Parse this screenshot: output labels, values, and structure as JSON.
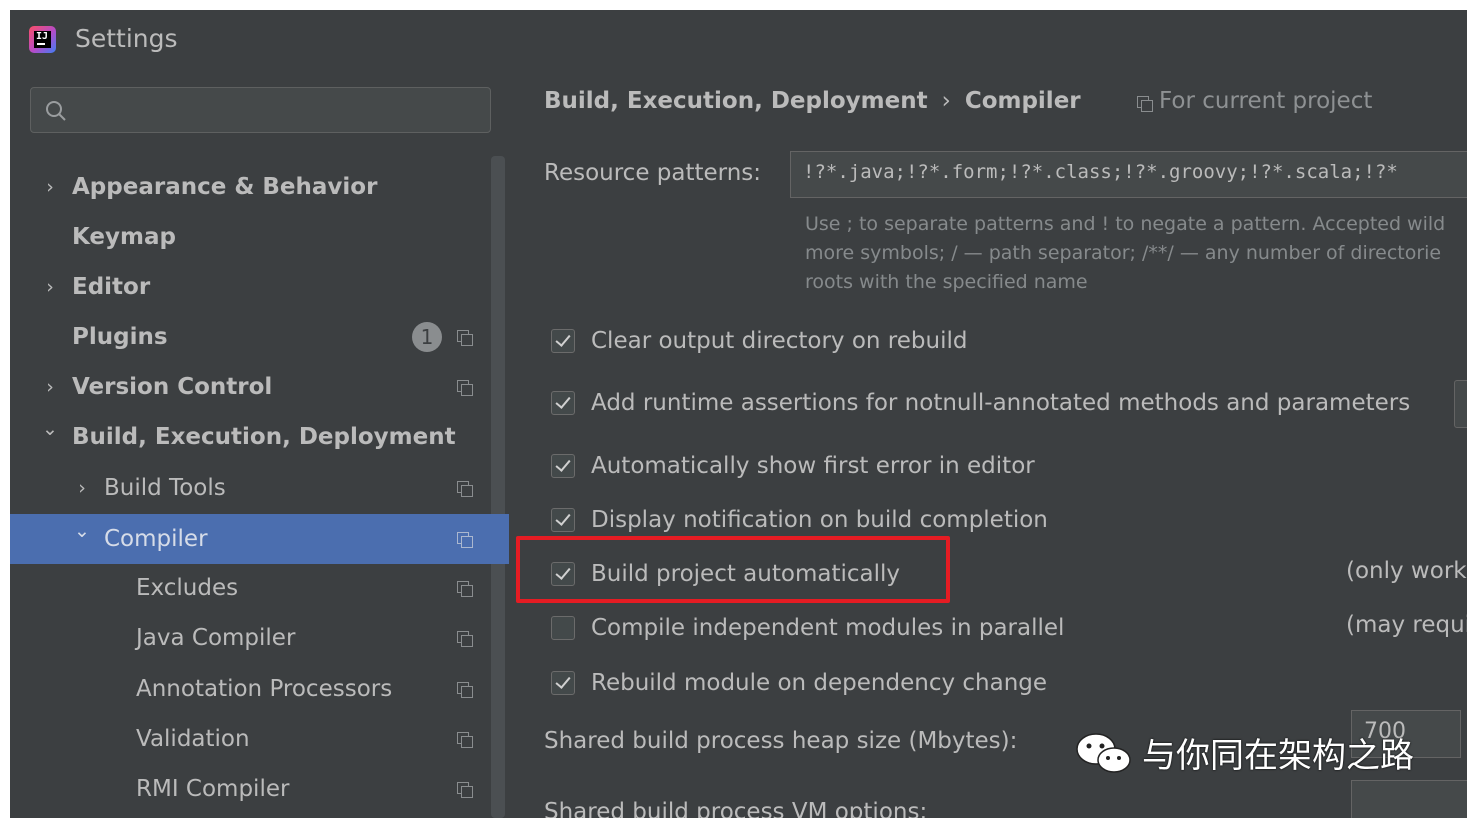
{
  "window": {
    "title": "Settings"
  },
  "search": {
    "placeholder": ""
  },
  "tree": [
    {
      "label": "Appearance & Behavior",
      "arrow": "›",
      "bold": true
    },
    {
      "label": "Keymap",
      "arrow": "",
      "bold": true
    },
    {
      "label": "Editor",
      "arrow": "›",
      "bold": true
    },
    {
      "label": "Plugins",
      "arrow": "",
      "bold": true,
      "badge": "1"
    },
    {
      "label": "Version Control",
      "arrow": "›",
      "bold": true
    },
    {
      "label": "Build, Execution, Deployment",
      "arrow": "⌄",
      "bold": true
    },
    {
      "label": "Build Tools",
      "arrow": "›",
      "bold": false
    },
    {
      "label": "Compiler",
      "arrow": "⌄",
      "bold": false,
      "selected": true
    },
    {
      "label": "Excludes",
      "arrow": "",
      "bold": false
    },
    {
      "label": "Java Compiler",
      "arrow": "",
      "bold": false
    },
    {
      "label": "Annotation Processors",
      "arrow": "",
      "bold": false
    },
    {
      "label": "Validation",
      "arrow": "",
      "bold": false
    },
    {
      "label": "RMI Compiler",
      "arrow": "",
      "bold": false
    }
  ],
  "breadcrumb": {
    "parent": "Build, Execution, Deployment",
    "separator": "›",
    "current": "Compiler",
    "scope": "For current project"
  },
  "resource": {
    "label": "Resource patterns:",
    "value": "!?*.java;!?*.form;!?*.class;!?*.groovy;!?*.scala;!?*",
    "hint_1": "Use ; to separate patterns and ! to negate a pattern. Accepted wild",
    "hint_2": "more symbols; / — path separator; /**/ — any number of directorie",
    "hint_3": "roots with the specified name"
  },
  "options": {
    "clear_output": {
      "label": "Clear output directory on rebuild",
      "checked": true
    },
    "runtime_assertions": {
      "label": "Add runtime assertions for notnull-annotated methods and parameters",
      "checked": true
    },
    "show_first_error": {
      "label": "Automatically show first error in editor",
      "checked": true
    },
    "notification": {
      "label": "Display notification on build completion",
      "checked": true
    },
    "build_auto": {
      "label": "Build project automatically",
      "checked": true,
      "note": "(only work"
    },
    "parallel": {
      "label": "Compile independent modules in parallel",
      "checked": false,
      "note": "(may requi"
    },
    "rebuild_dep": {
      "label": "Rebuild module on dependency change",
      "checked": true
    }
  },
  "heap": {
    "label": "Shared build process heap size (Mbytes):",
    "value": "700"
  },
  "vm": {
    "label": "Shared build process VM options:",
    "value": ""
  },
  "watermark": {
    "text": "与你同在架构之路"
  },
  "colors": {
    "background": "#3c3f41",
    "selection": "#4b6eaf",
    "highlight": "#e51c23"
  }
}
